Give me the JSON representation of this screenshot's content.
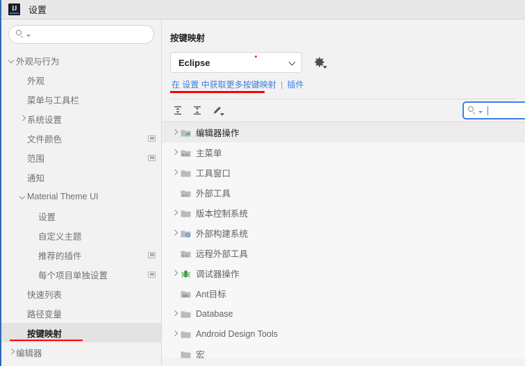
{
  "titlebar": {
    "logo_text": "IJ",
    "title": "设置"
  },
  "sidebar": {
    "search_placeholder": "",
    "search_value": "",
    "items": [
      {
        "label": "外观与行为",
        "indent": 0,
        "arrow": "expanded",
        "selected": false,
        "scope": false
      },
      {
        "label": "外观",
        "indent": 1,
        "arrow": "none",
        "selected": false,
        "scope": false
      },
      {
        "label": "菜单与工具栏",
        "indent": 1,
        "arrow": "none",
        "selected": false,
        "scope": false
      },
      {
        "label": "系统设置",
        "indent": 1,
        "arrow": "collapsed",
        "selected": false,
        "scope": false
      },
      {
        "label": "文件颜色",
        "indent": 1,
        "arrow": "none",
        "selected": false,
        "scope": true
      },
      {
        "label": "范围",
        "indent": 1,
        "arrow": "none",
        "selected": false,
        "scope": true
      },
      {
        "label": "通知",
        "indent": 1,
        "arrow": "none",
        "selected": false,
        "scope": false
      },
      {
        "label": "Material Theme UI",
        "indent": 1,
        "arrow": "expanded",
        "selected": false,
        "scope": false
      },
      {
        "label": "设置",
        "indent": 2,
        "arrow": "none",
        "selected": false,
        "scope": false
      },
      {
        "label": "自定义主题",
        "indent": 2,
        "arrow": "none",
        "selected": false,
        "scope": false
      },
      {
        "label": "推荐的插件",
        "indent": 2,
        "arrow": "none",
        "selected": false,
        "scope": true
      },
      {
        "label": "每个项目单独设置",
        "indent": 2,
        "arrow": "none",
        "selected": false,
        "scope": true
      },
      {
        "label": "快速列表",
        "indent": 1,
        "arrow": "none",
        "selected": false,
        "scope": false
      },
      {
        "label": "路径变量",
        "indent": 1,
        "arrow": "none",
        "selected": false,
        "scope": false
      },
      {
        "label": "按键映射",
        "indent": 1,
        "arrow": "none",
        "selected": true,
        "scope": false
      },
      {
        "label": "编辑器",
        "indent": 0,
        "arrow": "collapsed",
        "selected": false,
        "scope": false
      }
    ]
  },
  "panel": {
    "title": "按键映射",
    "keymap_combo": {
      "value": "Eclipse",
      "has_modified_dot": true
    },
    "gear_tooltip": "",
    "links": {
      "prefix": "在",
      "settings": "设置",
      "middle": "中获取更多按键映射",
      "separator": "|",
      "plugins": "插件"
    },
    "toolbar": {
      "expand_all": "expand-all",
      "collapse_all": "collapse-all",
      "edit": "edit-shortcut"
    },
    "search": {
      "value": "",
      "placeholder": ""
    },
    "tree": [
      {
        "label": "编辑器操作",
        "arrow": "collapsed",
        "icon": "folder-editor",
        "selected": true
      },
      {
        "label": "主菜单",
        "arrow": "collapsed",
        "icon": "folder-menu",
        "selected": false
      },
      {
        "label": "工具窗口",
        "arrow": "collapsed",
        "icon": "folder-plain",
        "selected": false
      },
      {
        "label": "外部工具",
        "arrow": "none",
        "icon": "folder-tools",
        "selected": false
      },
      {
        "label": "版本控制系统",
        "arrow": "collapsed",
        "icon": "folder-plain",
        "selected": false
      },
      {
        "label": "外部构建系统",
        "arrow": "collapsed",
        "icon": "folder-build",
        "selected": false
      },
      {
        "label": "远程外部工具",
        "arrow": "none",
        "icon": "folder-tools",
        "selected": false
      },
      {
        "label": "调试器操作",
        "arrow": "collapsed",
        "icon": "bug",
        "selected": false
      },
      {
        "label": "Ant目标",
        "arrow": "none",
        "icon": "folder-ant",
        "selected": false
      },
      {
        "label": "Database",
        "arrow": "collapsed",
        "icon": "folder-plain",
        "selected": false
      },
      {
        "label": "Android Design Tools",
        "arrow": "collapsed",
        "icon": "folder-plain",
        "selected": false
      },
      {
        "label": "宏",
        "arrow": "none",
        "icon": "folder-plain",
        "selected": false
      }
    ]
  },
  "annotations": {
    "sidebar_underline_color": "#ff0000",
    "combo_underline_color": "#ff0000",
    "focus_ring_color": "#3c7ff0"
  }
}
